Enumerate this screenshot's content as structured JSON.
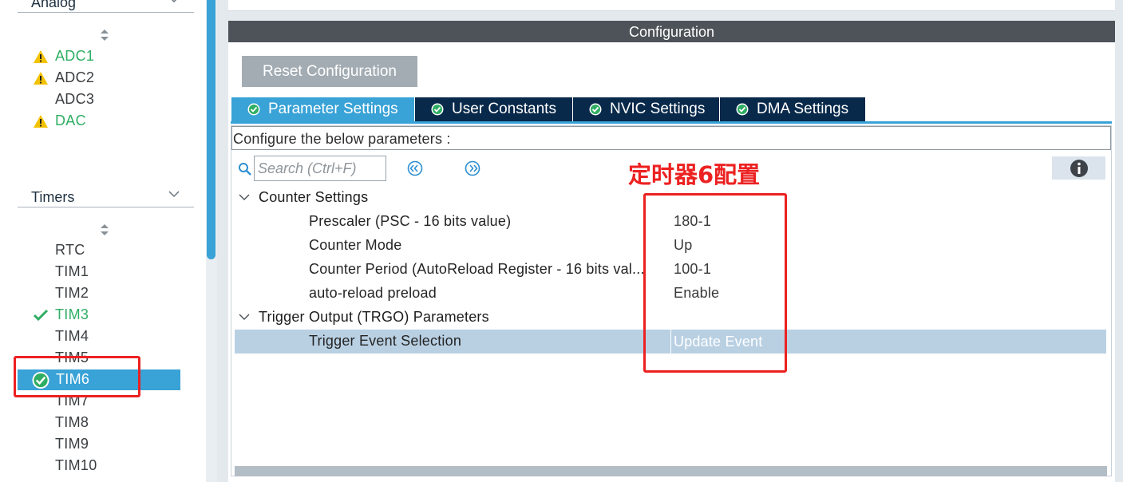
{
  "sidebar": {
    "analog_header": "Analog",
    "analog_items": [
      {
        "label": "ADC1",
        "status": "warning"
      },
      {
        "label": "ADC2",
        "status": "warning"
      },
      {
        "label": "ADC3",
        "status": "none"
      },
      {
        "label": "DAC",
        "status": "warning"
      }
    ],
    "timers_header": "Timers",
    "timer_items": [
      {
        "label": "RTC",
        "status": "none"
      },
      {
        "label": "TIM1",
        "status": "none"
      },
      {
        "label": "TIM2",
        "status": "none"
      },
      {
        "label": "TIM3",
        "status": "ok"
      },
      {
        "label": "TIM4",
        "status": "none"
      },
      {
        "label": "TIM5",
        "status": "none"
      },
      {
        "label": "TIM6",
        "status": "ok",
        "selected": true
      },
      {
        "label": "TIM7",
        "status": "none"
      },
      {
        "label": "TIM8",
        "status": "none"
      },
      {
        "label": "TIM9",
        "status": "none"
      },
      {
        "label": "TIM10",
        "status": "none"
      }
    ]
  },
  "config": {
    "title": "Configuration",
    "reset_label": "Reset Configuration",
    "tabs": [
      {
        "label": "Parameter Settings",
        "active": true
      },
      {
        "label": "User Constants"
      },
      {
        "label": "NVIC Settings"
      },
      {
        "label": "DMA Settings"
      }
    ],
    "configure_text": "Configure the below parameters :",
    "search_placeholder": "Search (Ctrl+F)",
    "groups": [
      {
        "label": "Counter Settings",
        "params": [
          {
            "name": "Prescaler (PSC - 16 bits value)",
            "value": "180-1"
          },
          {
            "name": "Counter Mode",
            "value": "Up"
          },
          {
            "name": "Counter Period (AutoReload Register - 16 bits val...",
            "value": "100-1"
          },
          {
            "name": "auto-reload preload",
            "value": "Enable"
          }
        ]
      },
      {
        "label": "Trigger Output (TRGO) Parameters",
        "params": [
          {
            "name": "Trigger Event Selection",
            "value": "Update Event",
            "selected": true
          }
        ]
      }
    ]
  },
  "annotation": {
    "text": "定时器6配置",
    "color": "#ec2121"
  },
  "colors": {
    "accent": "#39a2d6",
    "tab_dark": "#08294a",
    "ok_green": "#2fae63",
    "warning_yellow": "#f2c200"
  }
}
